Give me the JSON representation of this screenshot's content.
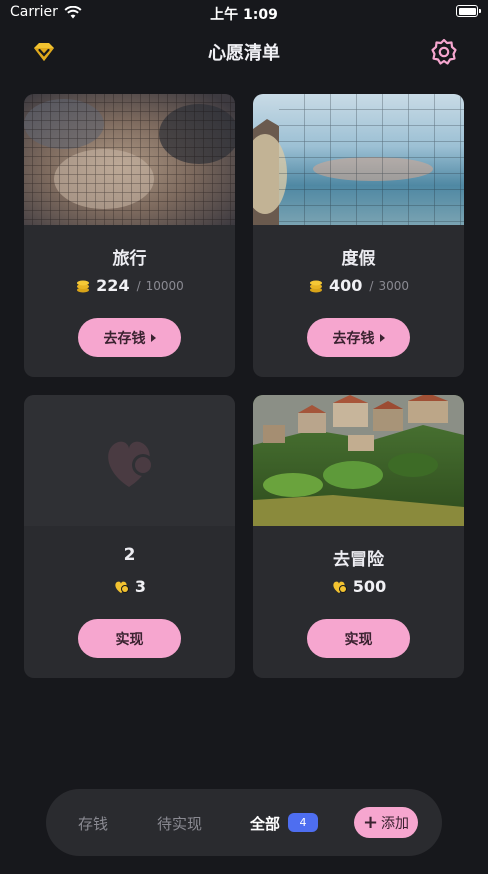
{
  "status_bar": {
    "carrier": "Carrier",
    "time": "上午 1:09"
  },
  "nav": {
    "title": "心愿清单",
    "left_icon": "vip-diamond-icon",
    "right_icon": "settings-gear-icon"
  },
  "colors": {
    "background": "#17181c",
    "card": "#2a2b2f",
    "accent_pink": "#f6a6cf",
    "coin_gold": "#f2c230",
    "badge_blue": "#4e6ef0"
  },
  "cards": [
    {
      "title": "旅行",
      "amount": "224",
      "separator": "/",
      "goal": "10000",
      "button": "去存钱",
      "icon": "coin-stack-icon",
      "image": "photo-cat-mosaic"
    },
    {
      "title": "度假",
      "amount": "400",
      "separator": "/",
      "goal": "3000",
      "button": "去存钱",
      "icon": "coin-stack-icon",
      "image": "photo-beach-grid"
    },
    {
      "title": "2",
      "amount": "3",
      "button": "实现",
      "icon": "heart-coin-icon",
      "image": "placeholder-heart"
    },
    {
      "title": "去冒险",
      "amount": "500",
      "button": "实现",
      "icon": "heart-coin-icon",
      "image": "photo-village-hillside"
    }
  ],
  "tabs": {
    "save": "存钱",
    "pending": "待实现",
    "all": "全部",
    "all_count": "4",
    "add": "添加"
  }
}
